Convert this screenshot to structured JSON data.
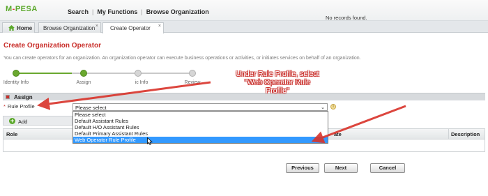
{
  "app": {
    "logo_text_a": "M",
    "logo_text_dash": "-",
    "logo_text_b": "PESA"
  },
  "topnav": {
    "items": [
      "Search",
      "My Functions",
      "Browse Organization"
    ],
    "separator": "|"
  },
  "tabs": [
    {
      "label": "Home"
    },
    {
      "label": "Browse Organization",
      "close": "×"
    },
    {
      "label": "Create Operator",
      "close": "×"
    }
  ],
  "page": {
    "title": "Create Organization Operator",
    "description": "You can create operators for an organization. An organization operator can execute business operations or activities, or initiates services on behalf of an organization."
  },
  "wizard": {
    "steps": [
      {
        "label": "Identity Info",
        "state": "done"
      },
      {
        "label": "Assign",
        "state": "done"
      },
      {
        "label": "ic Info",
        "state": "todo"
      },
      {
        "label": "Review",
        "state": "todo"
      }
    ]
  },
  "assign": {
    "section_label": "Assign",
    "field_required_mark": "*",
    "field_label": "Rule Profile",
    "select_value": "Please select",
    "caret": "⌄",
    "info": "i",
    "options": [
      {
        "label": "Please select",
        "selected": false
      },
      {
        "label": "Default Assistant Rules",
        "selected": false
      },
      {
        "label": "Default H/O Assistant Rules",
        "selected": false
      },
      {
        "label": "Default Primary Assistant Rules",
        "selected": false
      },
      {
        "label": "Web Operator Rule Profile",
        "selected": true
      }
    ],
    "add_label": "Add",
    "add_plus": "+"
  },
  "grid": {
    "columns": [
      "Role",
      "ate",
      "Description"
    ],
    "empty_text": "No records found."
  },
  "buttons": {
    "previous": "Previous",
    "next": "Next",
    "cancel": "Cancel"
  },
  "annotation": {
    "lines": [
      "Under Rule Profile, select",
      "\"Web Operator Rule",
      "Profile\""
    ],
    "color": "#c9302c"
  },
  "colors": {
    "accent_red": "#c9302c",
    "brand_green": "#5aa82a",
    "selection_blue": "#3399ff"
  }
}
